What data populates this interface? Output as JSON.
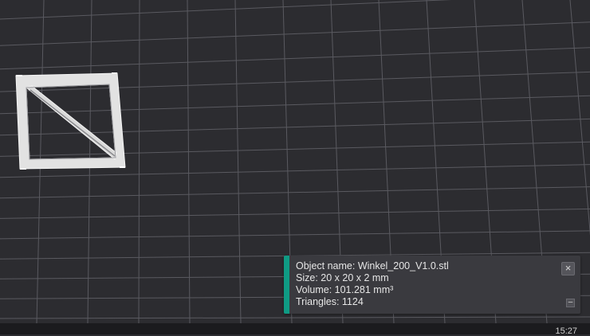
{
  "object_info": {
    "name_line": "Object name: Winkel_200_V1.0.stl",
    "size_line": "Size: 20 x 20 x 2 mm",
    "volume_line": "Volume: 101.281 mm³",
    "triangles_line": "Triangles: 1124",
    "close_icon": "×",
    "collapse_icon": "–",
    "accent_color": "#0f9b84"
  },
  "viewport": {
    "background_color": "#2c2c30",
    "grid_color": "#5a5a60",
    "model_color": "#e2e2e2"
  },
  "status_bar": {
    "clock": "15:27"
  }
}
